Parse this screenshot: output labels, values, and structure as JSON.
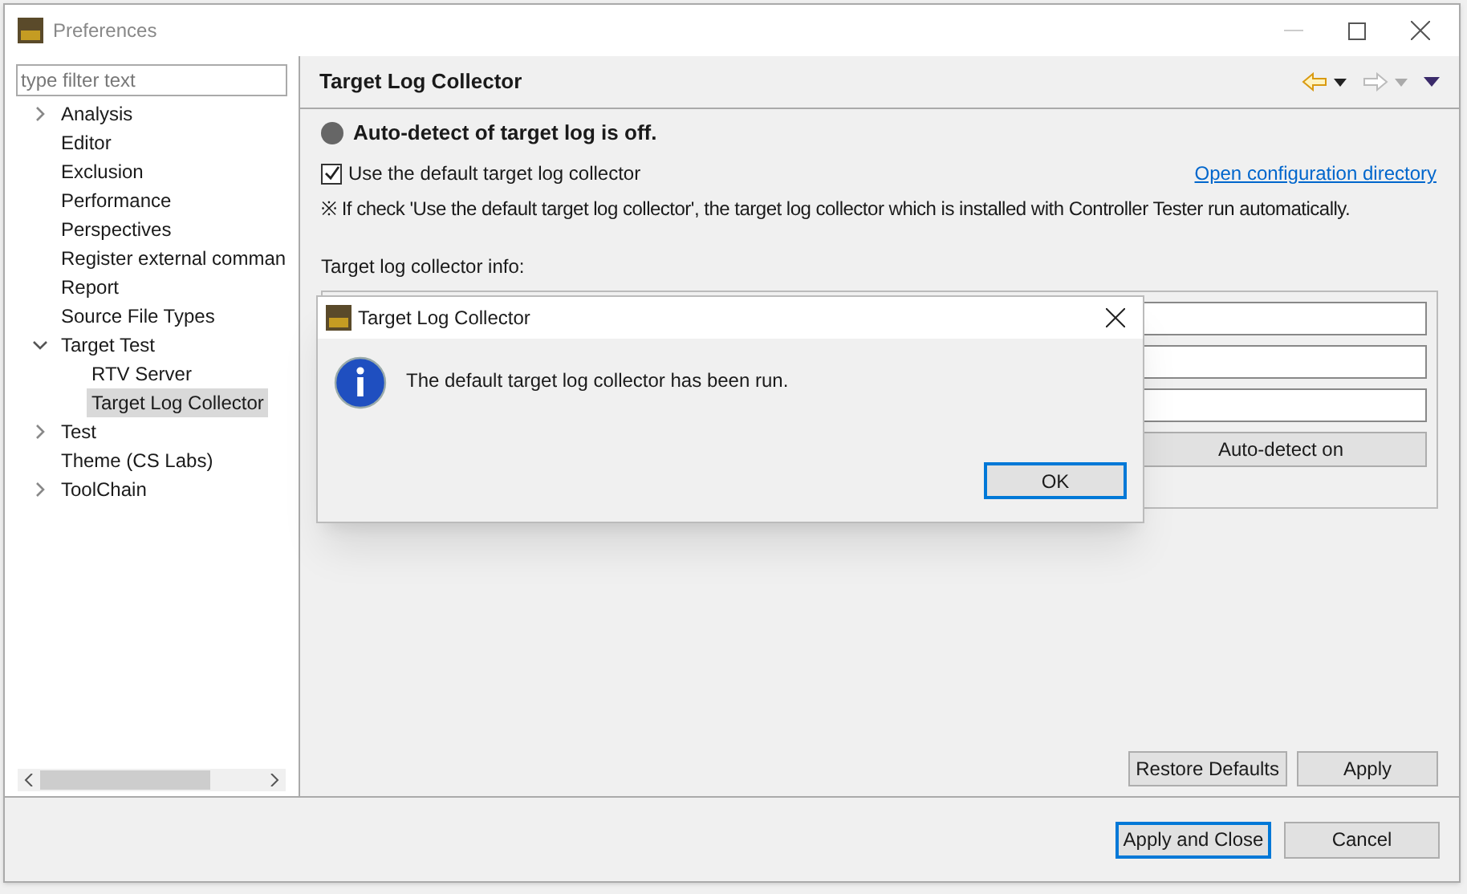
{
  "window": {
    "title": "Preferences"
  },
  "filter": {
    "placeholder": "type filter text"
  },
  "tree": [
    {
      "label": "Analysis",
      "expanded": false,
      "selected": false
    },
    {
      "label": "Editor",
      "selected": false
    },
    {
      "label": "Exclusion",
      "selected": false
    },
    {
      "label": "Performance",
      "selected": false
    },
    {
      "label": "Perspectives",
      "selected": false
    },
    {
      "label": "Register external comman",
      "selected": false
    },
    {
      "label": "Report",
      "selected": false
    },
    {
      "label": "Source File Types",
      "selected": false
    },
    {
      "label": "Target Test",
      "expanded": true,
      "selected": false,
      "children": [
        {
          "label": "RTV Server",
          "selected": false
        },
        {
          "label": "Target Log Collector",
          "selected": true
        }
      ]
    },
    {
      "label": "Test",
      "expanded": false,
      "selected": false
    },
    {
      "label": "Theme (CS Labs)",
      "selected": false
    },
    {
      "label": "ToolChain",
      "expanded": false,
      "selected": false
    }
  ],
  "page": {
    "title": "Target Log Collector",
    "status": {
      "text": "Auto-detect of target log is off.",
      "on": false
    },
    "checkbox": {
      "label": "Use the default target log collector",
      "checked": true
    },
    "link": "Open configuration directory",
    "note": "※ If check 'Use the default target log collector', the target log collector which is installed with Controller Tester run automatically.",
    "info_label": "Target log collector info:",
    "detect_button": "Auto-detect on",
    "buttons": [
      "Restore Defaults",
      "Apply"
    ]
  },
  "footer_buttons": [
    {
      "label": "Apply and Close",
      "default": true
    },
    {
      "label": "Cancel",
      "default": false
    }
  ],
  "dialog": {
    "title": "Target Log Collector",
    "message": "The default target log collector has been run.",
    "button": "OK"
  }
}
